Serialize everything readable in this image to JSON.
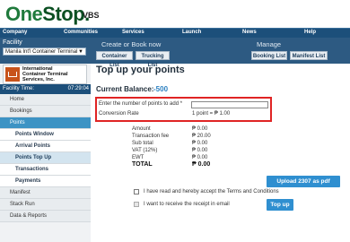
{
  "header": {
    "logo_main": "One",
    "logo_accent": "Stop.",
    "brand": "VBS"
  },
  "topmenu": [
    "Company",
    "Communities",
    "Services",
    "Launch",
    "News",
    "Help"
  ],
  "facility": {
    "title": "Facility",
    "selected": "Manila Int'l Container Terminal",
    "company_name": "International\nContainer Terminal\nServices, Inc.",
    "time_label": "Facility Time:",
    "time_value": "07:29:04"
  },
  "create": {
    "title": "Create or Book now",
    "buttons": [
      "Container List",
      "Trucking List"
    ]
  },
  "manage": {
    "title": "Manage",
    "buttons": [
      "Booking List",
      "Manifest List"
    ]
  },
  "nav": {
    "home": "Home",
    "bookings": "Bookings",
    "points": "Points",
    "points_window": "Points Window",
    "arrival_points": "Arrival Points",
    "points_top_up": "Points Top Up",
    "transactions": "Transactions",
    "payments": "Payments",
    "manifest": "Manifest",
    "stack_run": "Stack Run",
    "data_reports": "Data & Reports"
  },
  "main": {
    "title": "Top up your points",
    "balance_label": "Current Balance:",
    "balance_value": "-500",
    "points_label": "Enter the number of points to add *",
    "points_value": "",
    "conversion_label": "Conversion Rate",
    "conversion_value": "1 point = ₱ 1.00",
    "fees": [
      {
        "label": "Amount",
        "value": "₱ 0.00"
      },
      {
        "label": "Transaction fee",
        "value": "₱ 20.00"
      },
      {
        "label": "Sub total",
        "value": "₱ 0.00"
      },
      {
        "label": "VAT (12%)",
        "value": "₱ 0.00"
      },
      {
        "label": "EWT",
        "value": "₱ 0.00"
      },
      {
        "label": "TOTAL",
        "value": "₱ 0.00"
      }
    ],
    "upload_button": "Upload 2307 as pdf",
    "agree_label": "I have read and hereby accept the Terms and Conditions",
    "receipt_label": "I want to receive the receipt in email",
    "topup_button": "Top up"
  },
  "colors": {
    "brand_green": "#1f7a3c",
    "nav_blue": "#1c4f7a",
    "accent_blue": "#2f8fd0",
    "highlight_red": "#e02424"
  }
}
